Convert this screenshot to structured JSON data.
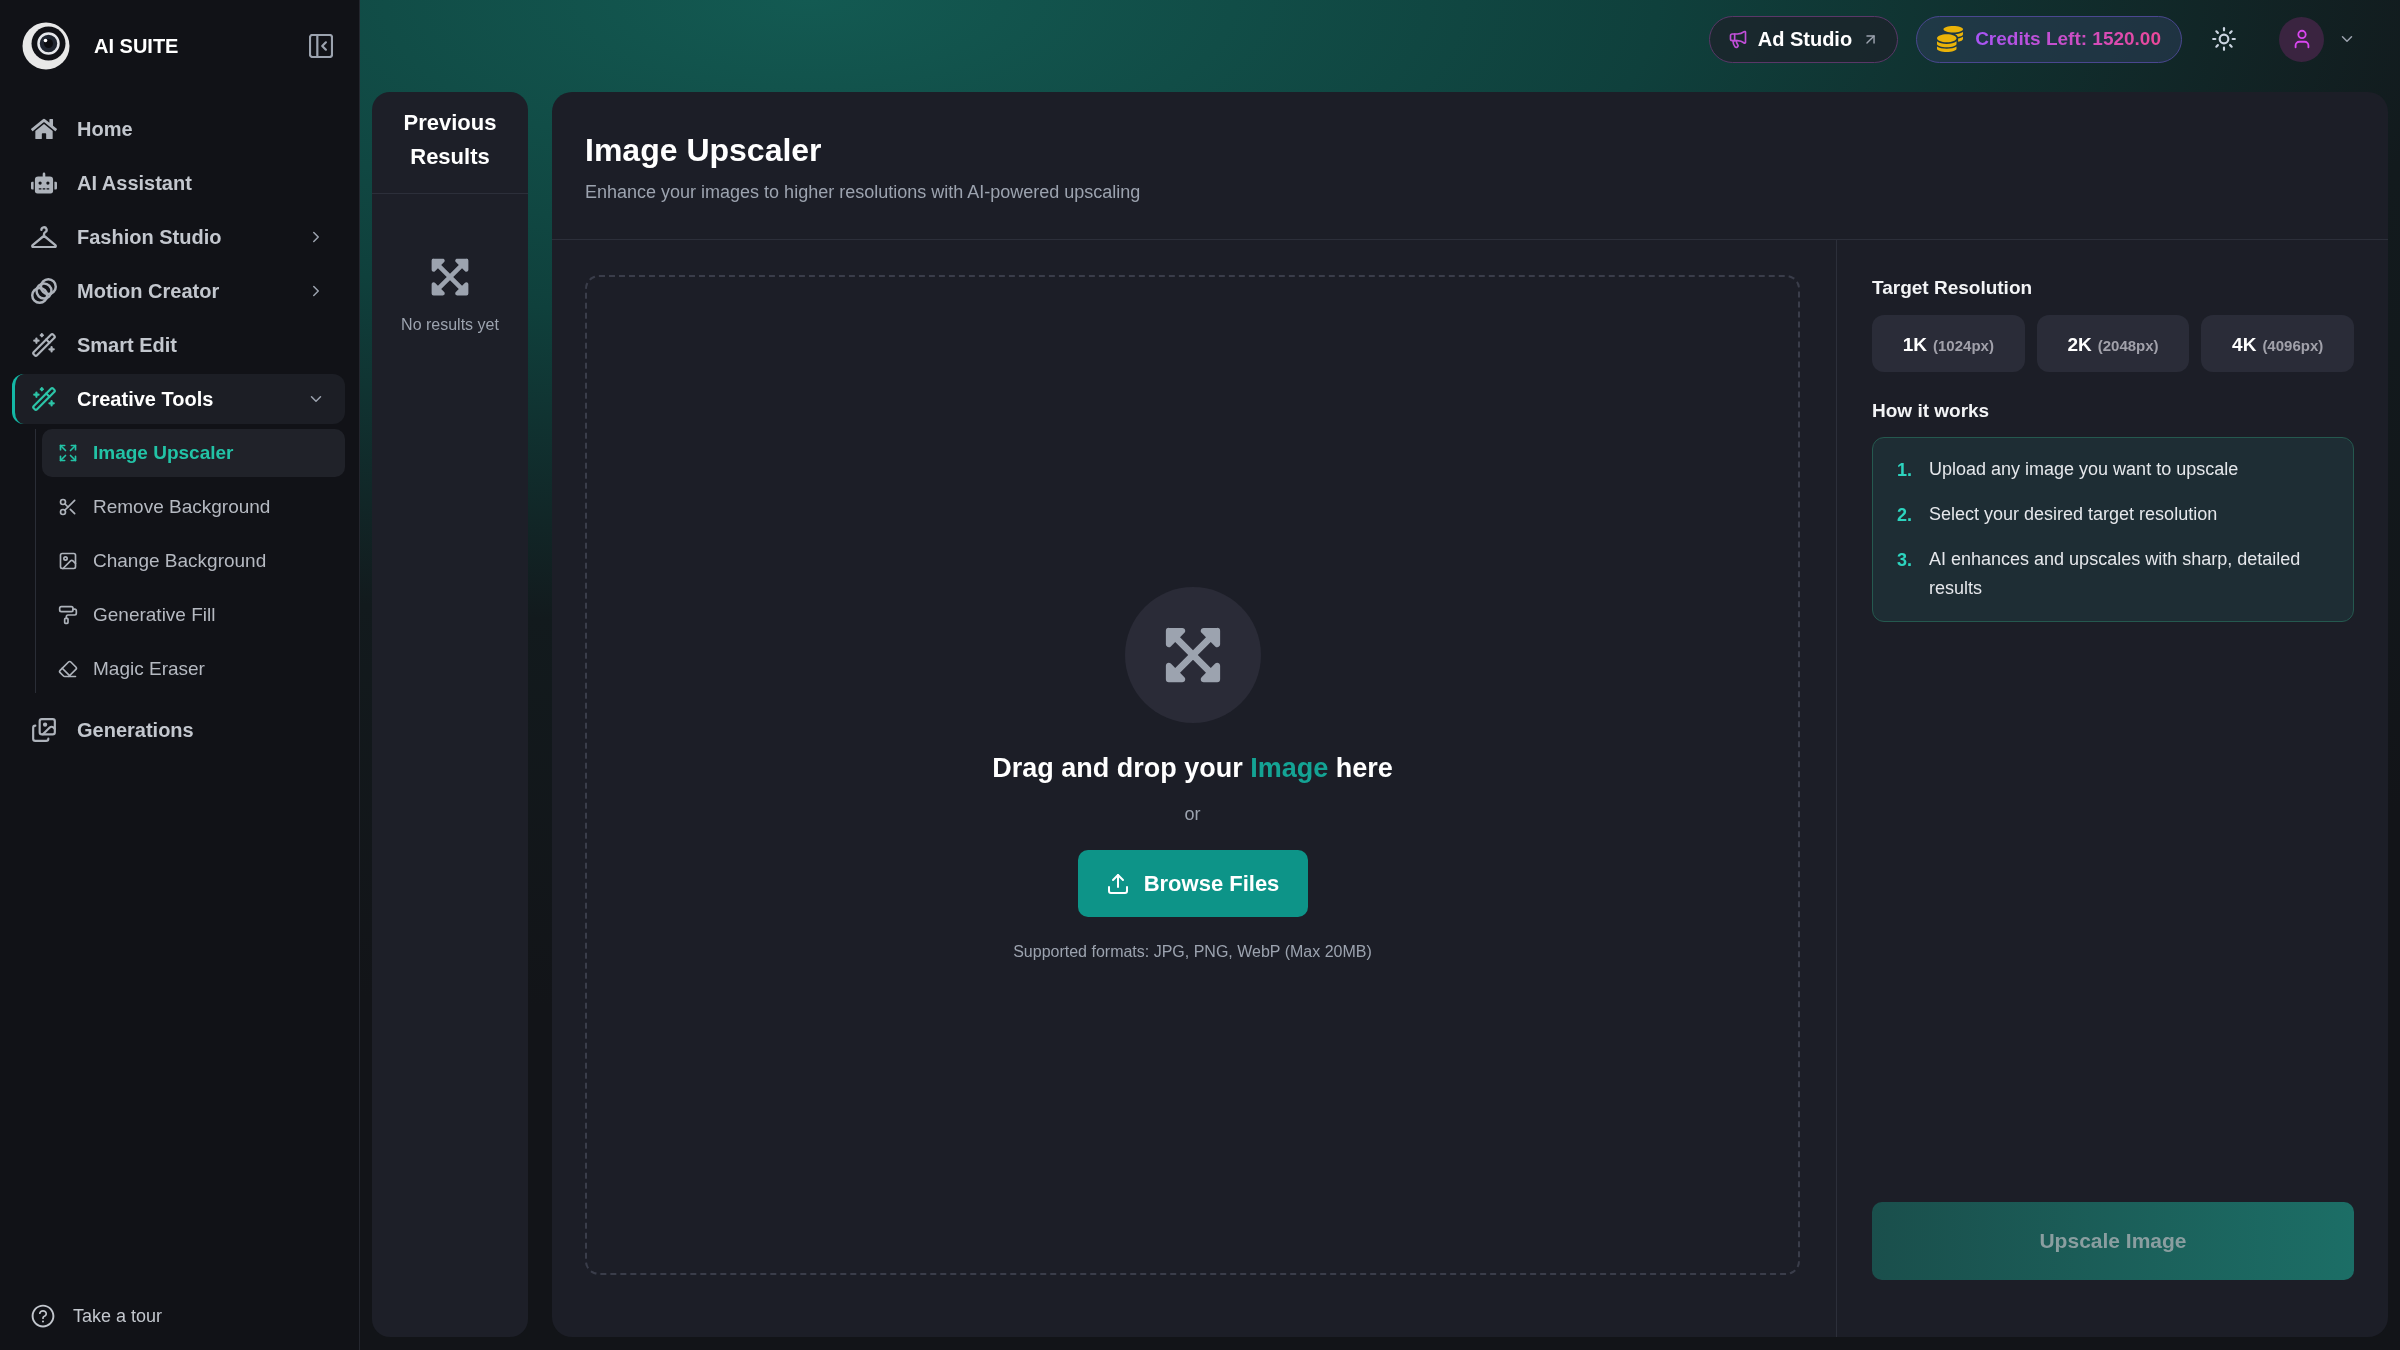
{
  "sidebar": {
    "brand": "AI SUITE",
    "items": [
      {
        "label": "Home",
        "selected": false
      },
      {
        "label": "AI Assistant",
        "selected": false
      },
      {
        "label": "Fashion Studio",
        "selected": false,
        "expanded": false
      },
      {
        "label": "Motion Creator",
        "selected": false,
        "expanded": false
      },
      {
        "label": "Smart Edit",
        "selected": false
      },
      {
        "label": "Creative Tools",
        "selected": true,
        "expanded": true,
        "children": [
          {
            "label": "Image Upscaler",
            "selected": true
          },
          {
            "label": "Remove Background",
            "selected": false
          },
          {
            "label": "Change Background",
            "selected": false
          },
          {
            "label": "Generative Fill",
            "selected": false
          },
          {
            "label": "Magic Eraser",
            "selected": false
          }
        ]
      },
      {
        "label": "Generations",
        "selected": false
      }
    ],
    "footer_link": "Take a tour"
  },
  "topbar": {
    "ad_studio": "Ad Studio",
    "credits": "Credits Left: 1520.00"
  },
  "previous_results": {
    "title": "Previous Results",
    "empty_text": "No results yet"
  },
  "page": {
    "title": "Image Upscaler",
    "subtitle": "Enhance your images to higher resolutions with AI-powered upscaling"
  },
  "dropzone": {
    "prompt": {
      "before": "Drag and drop your",
      "highlight": "Image",
      "after": "here"
    },
    "separator": "or",
    "button": "Browse Files",
    "note": "Supported formats: JPG, PNG, WebP (Max 20MB)"
  },
  "settings": {
    "resolution_label": "Target Resolution",
    "resolutions": [
      {
        "label": "1K",
        "detail": "(1024px)",
        "selected": false
      },
      {
        "label": "2K",
        "detail": "(2048px)",
        "selected": false
      },
      {
        "label": "4K",
        "detail": "(4096px)",
        "selected": false
      }
    ],
    "how_title": "How it works",
    "steps": [
      {
        "number": "1.",
        "text": "Upload any image you want to upscale"
      },
      {
        "number": "2.",
        "text": "Select your desired target resolution"
      },
      {
        "number": "3.",
        "text": "AI enhances and upscales with sharp, detailed results"
      }
    ],
    "submit": {
      "label": "Upscale Image",
      "disabled": true
    }
  }
}
